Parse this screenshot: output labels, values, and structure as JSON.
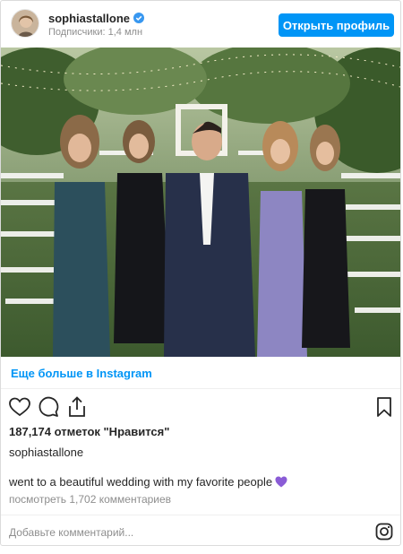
{
  "header": {
    "username": "sophiastallone",
    "followers": "Подписчики: 1,4 млн",
    "profile_button": "Открыть профиль"
  },
  "post": {
    "more_link": "Еще больше в Instagram",
    "likes": "187,174 отметок \"Нравится\"",
    "author": "sophiastallone",
    "caption": "went to a beautiful wedding with my favorite people",
    "comments_link": "посмотреть 1,702 комментариев"
  },
  "comment": {
    "placeholder": "Добавьте комментарий..."
  },
  "icons": {
    "like": "heart-icon",
    "comment": "comment-icon",
    "share": "share-icon",
    "save": "bookmark-icon",
    "instagram": "instagram-icon",
    "verified": "verified-badge-icon"
  },
  "colors": {
    "accent": "#0095f6",
    "text": "#262626",
    "muted": "#8e8e8e",
    "emoji_heart": "#8a5cd6"
  }
}
